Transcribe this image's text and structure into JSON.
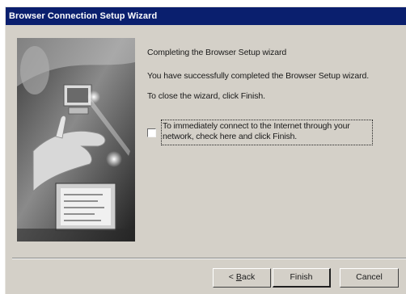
{
  "window": {
    "title": "Browser Connection Setup Wizard"
  },
  "content": {
    "heading": "Completing the Browser Setup wizard",
    "success_message": "You have successfully completed the Browser Setup wizard.",
    "close_instruction": "To close the wizard, click Finish.",
    "connect_option": {
      "checked": false,
      "label": "To immediately connect to the Internet through your network, check here and click Finish."
    }
  },
  "buttons": {
    "back": {
      "prefix": "< ",
      "accel": "B",
      "rest": "ack"
    },
    "finish": "Finish",
    "cancel": "Cancel"
  },
  "illustration": {
    "icon": "wizard-illustration-computer-hand"
  }
}
